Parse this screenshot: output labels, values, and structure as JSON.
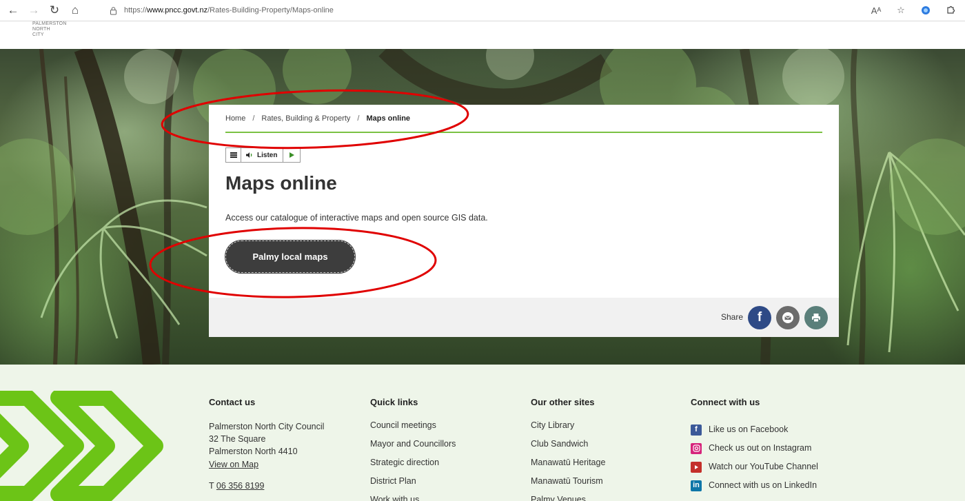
{
  "browser": {
    "url_prefix": "https://",
    "url_host": "www.pncc.govt.nz",
    "url_path": "/Rates-Building-Property/Maps-online",
    "read_aloud": "Aᴬ"
  },
  "site": {
    "logo_lines": [
      "PALMERSTON",
      "NORTH",
      "CITY"
    ]
  },
  "breadcrumb": {
    "home": "Home",
    "section": "Rates, Building & Property",
    "current": "Maps online",
    "separator": "/"
  },
  "listen": {
    "label": "Listen"
  },
  "page": {
    "title": "Maps online",
    "lead": "Access our catalogue of interactive maps and open source GIS data.",
    "cta": "Palmy local maps"
  },
  "share": {
    "label": "Share",
    "fb_glyph": "f"
  },
  "footer": {
    "contact": {
      "heading": "Contact us",
      "lines": [
        "Palmerston North City Council",
        "32 The Square",
        "Palmerston North 4410"
      ],
      "map_link": "View on Map",
      "phone_prefix": "T",
      "phone": "06 356 8199"
    },
    "quick_links": {
      "heading": "Quick links",
      "items": [
        "Council meetings",
        "Mayor and Councillors",
        "Strategic direction",
        "District Plan",
        "Work with us"
      ]
    },
    "other_sites": {
      "heading": "Our other sites",
      "items": [
        "City Library",
        "Club Sandwich",
        "Manawatū Heritage",
        "Manawatū Tourism",
        "Palmy Venues"
      ]
    },
    "connect": {
      "heading": "Connect with us",
      "items": [
        "Like us on Facebook",
        "Check us out on Instagram",
        "Watch our YouTube Channel",
        "Connect with us on LinkedIn"
      ]
    }
  },
  "colors": {
    "accent_green": "#7ac142",
    "annotation_red": "#e00000",
    "cta_bg": "#3d3d3d",
    "facebook": "#2e4a86"
  }
}
